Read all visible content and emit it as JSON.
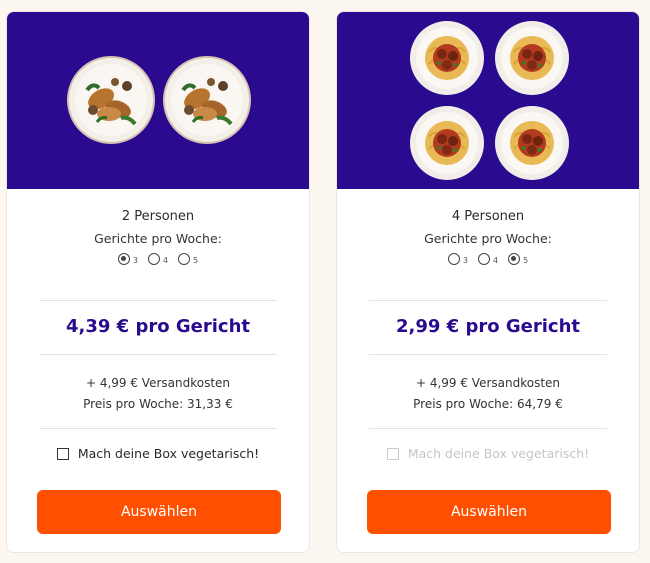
{
  "colors": {
    "brand": "#2a0a8f",
    "accent": "#ff4f00",
    "background": "#fdf7f1"
  },
  "cards": [
    {
      "image": "two-plates-chicken-mushroom-icon",
      "persons": "2 Personen",
      "meals_label": "Gerichte pro Woche:",
      "options": [
        {
          "label": "3",
          "selected": true
        },
        {
          "label": "4",
          "selected": false
        },
        {
          "label": "5",
          "selected": false
        }
      ],
      "price": "4,39 € pro Gericht",
      "shipping": "+ 4,99 € Versandkosten",
      "weekly": "Preis pro Woche: 31,33 €",
      "veg_label": "Mach deine Box vegetarisch!",
      "veg_enabled": true,
      "button": "Auswählen"
    },
    {
      "image": "four-plates-spaghetti-icon",
      "persons": "4 Personen",
      "meals_label": "Gerichte pro Woche:",
      "options": [
        {
          "label": "3",
          "selected": false
        },
        {
          "label": "4",
          "selected": false
        },
        {
          "label": "5",
          "selected": true
        }
      ],
      "price": "2,99 € pro Gericht",
      "shipping": "+ 4,99 € Versandkosten",
      "weekly": "Preis pro Woche: 64,79 €",
      "veg_label": "Mach deine Box vegetarisch!",
      "veg_enabled": false,
      "button": "Auswählen"
    }
  ]
}
